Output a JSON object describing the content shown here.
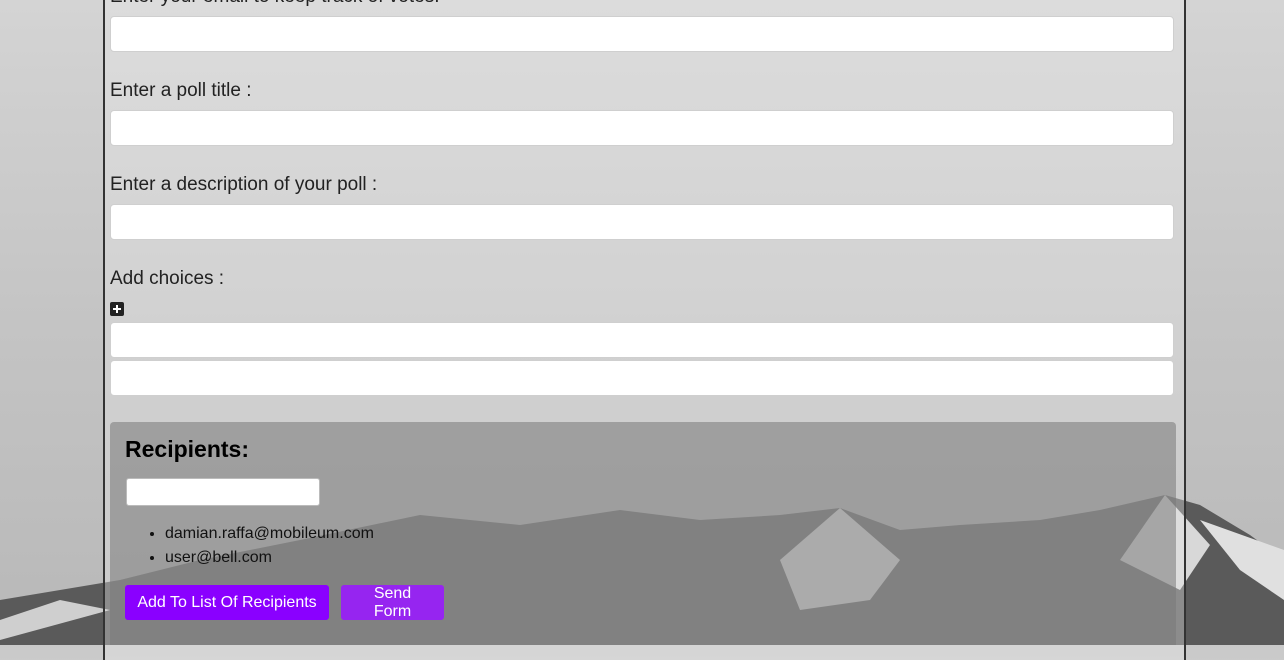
{
  "form": {
    "email_label": "Enter your email to keep track of votes:",
    "title_label": "Enter a poll title :",
    "description_label": "Enter a description of your poll :",
    "choices_label": "Add choices :"
  },
  "recipients": {
    "title": "Recipients:",
    "list": [
      "damian.raffa@mobileum.com",
      "user@bell.com"
    ],
    "add_button": "Add To List Of Recipients",
    "send_button": "Send Form"
  },
  "icons": {
    "add_choice": "plus-square-icon"
  },
  "colors": {
    "button": "#8a00ff",
    "panel": "#787878"
  }
}
